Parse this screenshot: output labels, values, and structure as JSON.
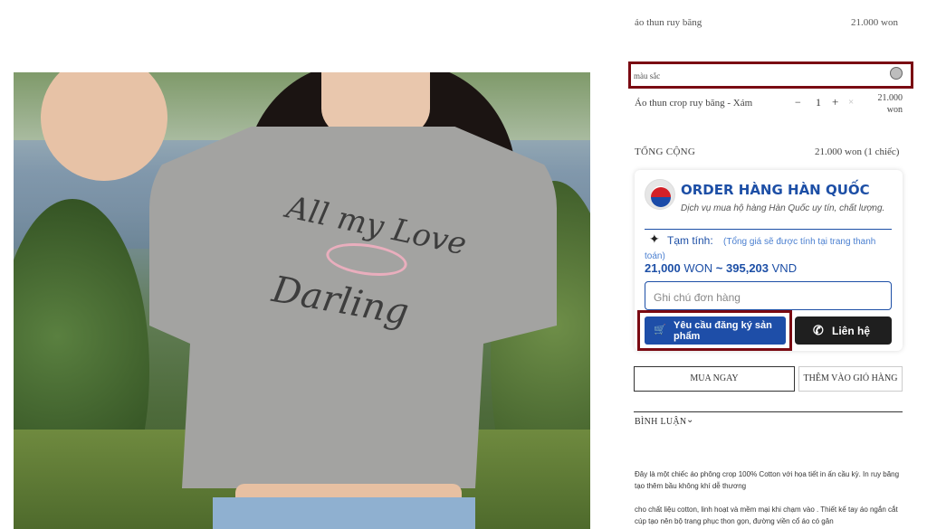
{
  "product": {
    "title": "áo thun ruy băng",
    "price": "21.000 won",
    "image_alt": "",
    "print_line1": "All my Love",
    "print_line2": "Darling"
  },
  "color_selector": {
    "label": "màu sắc",
    "swatch_color": "#bdbdbd"
  },
  "cart_item": {
    "name": "Áo thun crop ruy băng - Xám",
    "qty_minus": "−",
    "qty": "1",
    "qty_plus": "+",
    "remove": "×",
    "price": "21.000 won"
  },
  "total": {
    "label": "TỔNG CỘNG",
    "value": "21.000 won (1 chiếc)"
  },
  "order_widget": {
    "brand": "ORDER HÀNG HÀN QUỐC",
    "tagline": "Dịch vụ mua hộ hàng Hàn Quốc uy tín, chất lượng.",
    "subtotal_label": "Tạm tính:",
    "subtotal_note": "(Tổng giá sẽ được tính tại trang thanh toán)",
    "price_won_num": "21,000",
    "price_won_unit": "WON",
    "price_sep": "~",
    "price_vnd_num": "395,203",
    "price_vnd_unit": "VND",
    "note_placeholder": "Ghi chú đơn hàng",
    "request_button": "Yêu cầu đăng ký sản phẩm",
    "contact_button": "Liên hệ",
    "brand_color": "#1d4fa6"
  },
  "actions": {
    "buy_now": "MUA NGAY",
    "add_to_cart": "THÊM VÀO GIỎ HÀNG"
  },
  "reviews": {
    "label": "BÌNH LUẬN"
  },
  "description": {
    "p1": "Đây là một chiếc áo phông crop 100% Cotton với họa tiết in ấn cầu kỳ. In ruy băng tạo thêm bầu không khí dễ thương",
    "p2": "cho chất liệu cotton, linh hoạt và mềm mại khi chạm vào . Thiết kế tay áo ngắn cắt cúp tạo nên bộ trang phục thon gọn, đường viền cổ áo có gân"
  }
}
